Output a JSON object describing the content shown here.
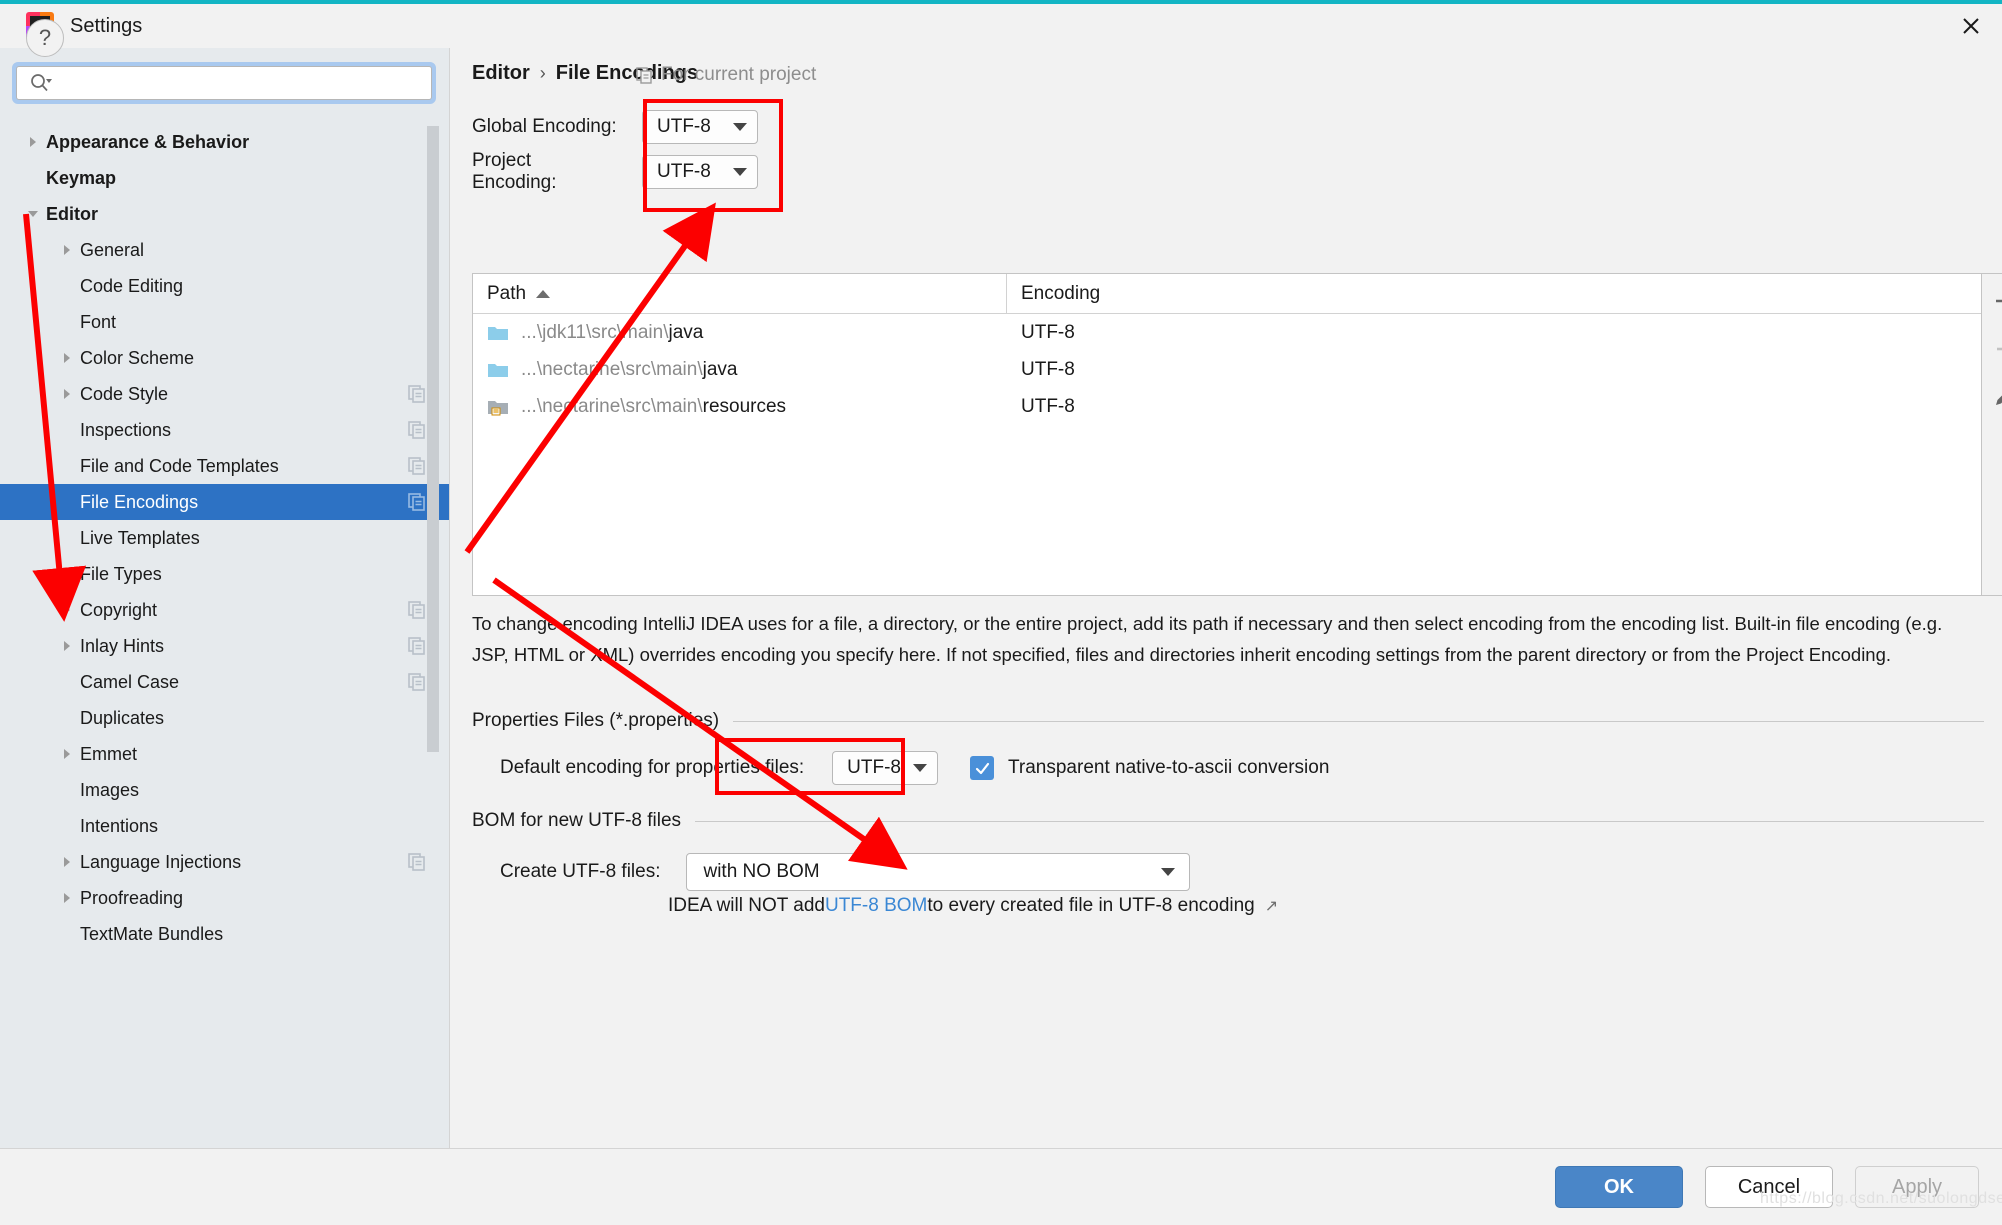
{
  "window": {
    "title": "Settings",
    "logo_text": "IJ",
    "close_icon": "close-icon",
    "accent_color": "#12b5c4"
  },
  "search": {
    "value": "",
    "placeholder": "",
    "icon": "search-icon"
  },
  "sidebar": {
    "items": [
      {
        "label": "Appearance & Behavior",
        "arrow": "collapsed",
        "bold": true,
        "indent": 0,
        "badge": false,
        "selected": false
      },
      {
        "label": "Keymap",
        "arrow": "none",
        "bold": true,
        "indent": 0,
        "badge": false,
        "selected": false
      },
      {
        "label": "Editor",
        "arrow": "expanded",
        "bold": true,
        "indent": 0,
        "badge": false,
        "selected": false
      },
      {
        "label": "General",
        "arrow": "collapsed",
        "bold": false,
        "indent": 1,
        "badge": false,
        "selected": false
      },
      {
        "label": "Code Editing",
        "arrow": "none",
        "bold": false,
        "indent": 1,
        "badge": false,
        "selected": false
      },
      {
        "label": "Font",
        "arrow": "none",
        "bold": false,
        "indent": 1,
        "badge": false,
        "selected": false
      },
      {
        "label": "Color Scheme",
        "arrow": "collapsed",
        "bold": false,
        "indent": 1,
        "badge": false,
        "selected": false
      },
      {
        "label": "Code Style",
        "arrow": "collapsed",
        "bold": false,
        "indent": 1,
        "badge": true,
        "selected": false
      },
      {
        "label": "Inspections",
        "arrow": "none",
        "bold": false,
        "indent": 1,
        "badge": true,
        "selected": false
      },
      {
        "label": "File and Code Templates",
        "arrow": "none",
        "bold": false,
        "indent": 1,
        "badge": true,
        "selected": false
      },
      {
        "label": "File Encodings",
        "arrow": "none",
        "bold": false,
        "indent": 1,
        "badge": true,
        "selected": true
      },
      {
        "label": "Live Templates",
        "arrow": "none",
        "bold": false,
        "indent": 1,
        "badge": false,
        "selected": false
      },
      {
        "label": "File Types",
        "arrow": "none",
        "bold": false,
        "indent": 1,
        "badge": false,
        "selected": false
      },
      {
        "label": "Copyright",
        "arrow": "collapsed",
        "bold": false,
        "indent": 1,
        "badge": true,
        "selected": false
      },
      {
        "label": "Inlay Hints",
        "arrow": "collapsed",
        "bold": false,
        "indent": 1,
        "badge": true,
        "selected": false
      },
      {
        "label": "Camel Case",
        "arrow": "none",
        "bold": false,
        "indent": 1,
        "badge": true,
        "selected": false
      },
      {
        "label": "Duplicates",
        "arrow": "none",
        "bold": false,
        "indent": 1,
        "badge": false,
        "selected": false
      },
      {
        "label": "Emmet",
        "arrow": "collapsed",
        "bold": false,
        "indent": 1,
        "badge": false,
        "selected": false
      },
      {
        "label": "Images",
        "arrow": "none",
        "bold": false,
        "indent": 1,
        "badge": false,
        "selected": false
      },
      {
        "label": "Intentions",
        "arrow": "none",
        "bold": false,
        "indent": 1,
        "badge": false,
        "selected": false
      },
      {
        "label": "Language Injections",
        "arrow": "collapsed",
        "bold": false,
        "indent": 1,
        "badge": true,
        "selected": false
      },
      {
        "label": "Proofreading",
        "arrow": "collapsed",
        "bold": false,
        "indent": 1,
        "badge": false,
        "selected": false
      },
      {
        "label": "TextMate Bundles",
        "arrow": "none",
        "bold": false,
        "indent": 1,
        "badge": false,
        "selected": false
      }
    ]
  },
  "header": {
    "breadcrumb_parent": "Editor",
    "breadcrumb_sep": "›",
    "breadcrumb_current": "File Encodings",
    "scope_badge": "For current project",
    "scope_badge_icon": "copy-icon"
  },
  "encoding": {
    "global_label": "Global Encoding:",
    "global_value": "UTF-8",
    "project_label": "Project Encoding:",
    "project_value": "UTF-8"
  },
  "table": {
    "columns": [
      "Path",
      "Encoding"
    ],
    "sort_column": "Path",
    "sort_direction": "asc",
    "rows": [
      {
        "dim": "...\\jdk11\\src\\main\\",
        "name": "java",
        "encoding": "UTF-8",
        "icon": "folder-icon-source"
      },
      {
        "dim": "...\\nectarine\\src\\main\\",
        "name": "java",
        "encoding": "UTF-8",
        "icon": "folder-icon-source"
      },
      {
        "dim": "...\\nectarine\\src\\main\\",
        "name": "resources",
        "encoding": "UTF-8",
        "icon": "folder-icon-resources"
      }
    ],
    "tools": [
      {
        "name": "add-path-button",
        "icon": "plus-icon",
        "enabled": true
      },
      {
        "name": "remove-path-button",
        "icon": "minus-icon",
        "enabled": false
      },
      {
        "name": "edit-path-button",
        "icon": "pencil-icon",
        "enabled": true
      }
    ]
  },
  "description": "To change encoding IntelliJ IDEA uses for a file, a directory, or the entire project, add its path if necessary and then select encoding from the encoding list. Built-in file encoding (e.g. JSP, HTML or XML) overrides encoding you specify here. If not specified, files and directories inherit encoding settings from the parent directory or from the Project Encoding.",
  "properties_section": {
    "title": "Properties Files (*.properties)",
    "default_encoding_label": "Default encoding for properties files:",
    "default_encoding_value": "UTF-8",
    "transparent_label": "Transparent native-to-ascii conversion",
    "transparent_checked": true
  },
  "bom_section": {
    "title": "BOM for new UTF-8 files",
    "create_label": "Create UTF-8 files:",
    "create_value": "with NO BOM",
    "hint_prefix": "IDEA will NOT add ",
    "hint_link": "UTF-8 BOM",
    "hint_suffix": " to every created file in UTF-8 encoding",
    "hint_arrow": "↗"
  },
  "footer": {
    "help_label": "?",
    "ok_label": "OK",
    "cancel_label": "Cancel",
    "apply_label": "Apply",
    "apply_enabled": false,
    "watermark": "https://blog.csdn.net/suolongdse"
  },
  "annotations": {
    "color": "#fc0000",
    "boxes": [
      {
        "name": "encoding-dropdowns-highlight"
      },
      {
        "name": "properties-encoding-highlight"
      }
    ],
    "arrows": [
      {
        "name": "arrow-to-file-encodings"
      },
      {
        "name": "arrow-to-encoding-dropdowns"
      },
      {
        "name": "arrow-to-properties-encoding"
      }
    ]
  }
}
